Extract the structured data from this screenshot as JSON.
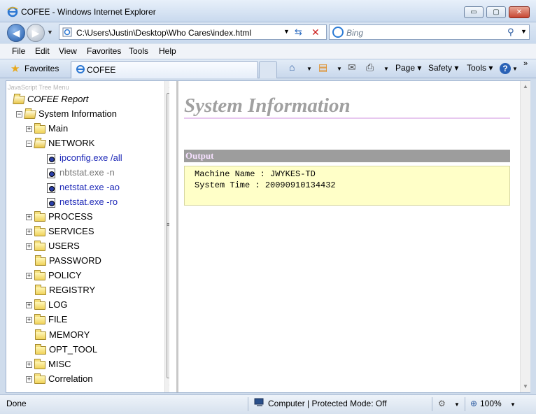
{
  "window": {
    "title": "COFEE - Windows Internet Explorer",
    "minimize_label": "▭",
    "maximize_label": "▢",
    "close_label": "✕"
  },
  "address": {
    "url": "C:\\Users\\Justin\\Desktop\\Who Cares\\index.html",
    "search_placeholder": "Bing"
  },
  "menu": [
    "File",
    "Edit",
    "View",
    "Favorites",
    "Tools",
    "Help"
  ],
  "favorites_bar": {
    "favorites_label": "Favorites",
    "tab_label": "COFEE"
  },
  "command_bar": {
    "page_label": "Page",
    "safety_label": "Safety",
    "tools_label": "Tools",
    "help_icon": "?"
  },
  "tree": {
    "caption": "JavaScript Tree Menu",
    "root": "COFEE Report",
    "system_info": "System Information",
    "items": {
      "main": "Main",
      "network": "NETWORK",
      "ipconfig": "ipconfig.exe /all",
      "nbtstat": "nbtstat.exe -n",
      "netstat_ao": "netstat.exe -ao",
      "netstat_ro": "netstat.exe -ro",
      "process": "PROCESS",
      "services": "SERVICES",
      "users": "USERS",
      "password": "PASSWORD",
      "policy": "POLICY",
      "registry": "REGISTRY",
      "log": "LOG",
      "file": "FILE",
      "memory": "MEMORY",
      "opt_tool": "OPT_TOOL",
      "misc": "MISC",
      "correlation": "Correlation"
    }
  },
  "main": {
    "page_title": "System Information",
    "output_header": "Output",
    "machine_name_line": "Machine Name : JWYKES-TD",
    "system_time_line": "System Time : 20090910134432"
  },
  "status": {
    "text": "Done",
    "zone": "Computer | Protected Mode: Off",
    "zoom": "100%"
  },
  "colors": {
    "link": "#1f2ab8",
    "visited": "#777777",
    "output_bg": "#ffffc8",
    "title_gray": "#a0a0a0"
  }
}
